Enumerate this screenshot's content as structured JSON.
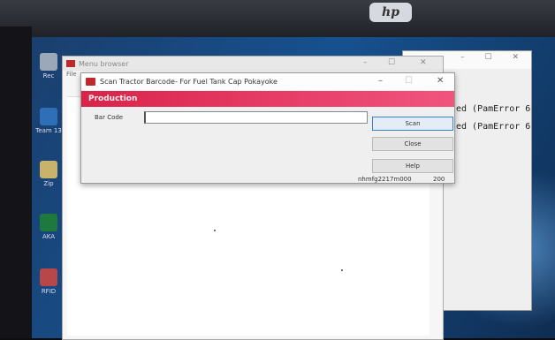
{
  "monitor": {
    "brand": "hp"
  },
  "desktop": {
    "icons": [
      {
        "label": "Rec",
        "icon": "recycle-bin-icon"
      },
      {
        "label": "Team 13",
        "icon": "teamviewer-icon"
      },
      {
        "label": "Zip",
        "icon": "zip-icon"
      },
      {
        "label": "AKA",
        "icon": "excel-icon"
      },
      {
        "label": "RFID",
        "icon": "rfid-icon"
      }
    ]
  },
  "console_window": {
    "lines": [
      "ed (PamError 6",
      "ed (PamError 6"
    ]
  },
  "menu_browser": {
    "title": "Menu browser",
    "menu": "File"
  },
  "dialog": {
    "title": "Scan Tractor Barcode- For Fuel Tank Cap Pokayoke",
    "banner": "Production",
    "barcode_label": "Bar Code",
    "barcode_value": "",
    "buttons": {
      "scan": "Scan",
      "close": "Close",
      "help": "Help"
    },
    "status_user": "nhmfg2217m000",
    "status_code": "200"
  },
  "colors": {
    "banner": "#e2335d",
    "desktop": "#16518f"
  }
}
